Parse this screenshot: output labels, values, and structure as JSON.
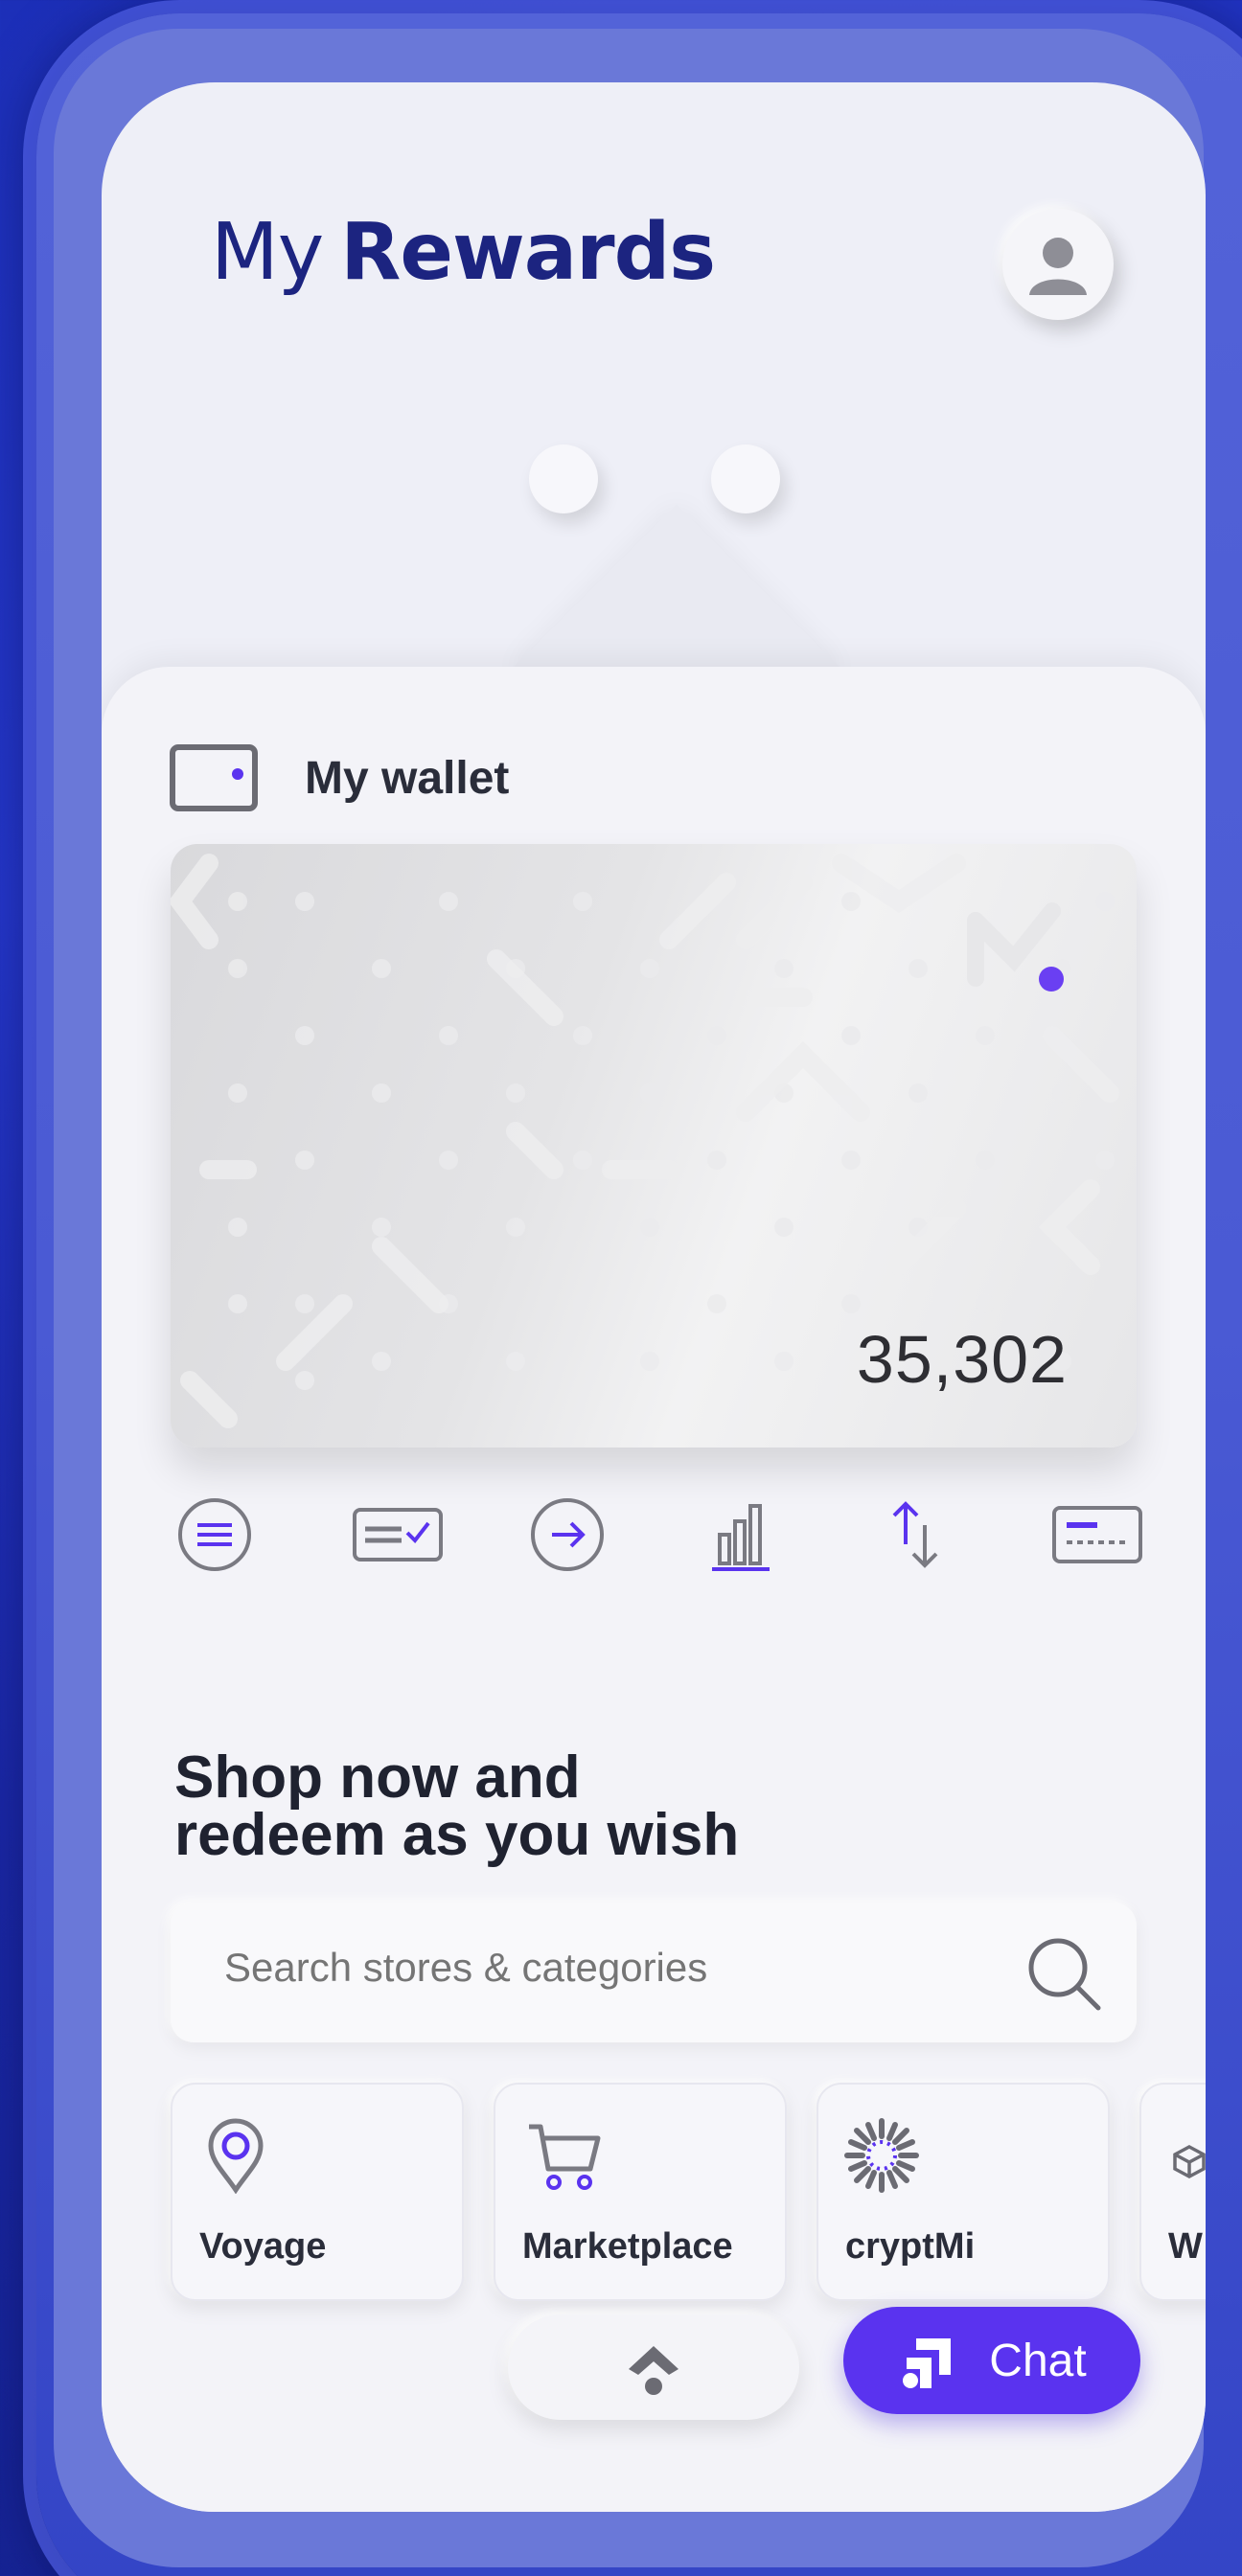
{
  "header": {
    "title_light": "My",
    "title_bold": "Rewards",
    "avatar_icon": "user-avatar-icon"
  },
  "wallet": {
    "label": "My wallet",
    "icon": "wallet-icon",
    "balance": "35,302",
    "accent": "#6a3ff2"
  },
  "actions": [
    {
      "icon": "menu-circle-icon"
    },
    {
      "icon": "card-check-icon"
    },
    {
      "icon": "arrow-right-circle-icon"
    },
    {
      "icon": "bar-chart-icon"
    },
    {
      "icon": "swap-arrows-icon"
    },
    {
      "icon": "credit-card-icon"
    }
  ],
  "shop": {
    "title_line1": "Shop now and",
    "title_line2": "redeem as you wish"
  },
  "search": {
    "placeholder": "Search stores & categories",
    "icon": "search-icon"
  },
  "categories": [
    {
      "label": "Voyage",
      "icon": "location-pin-icon"
    },
    {
      "label": "Marketplace",
      "icon": "shopping-cart-icon"
    },
    {
      "label": "cryptMi",
      "icon": "crypto-burst-icon"
    },
    {
      "label": "W",
      "icon": "cube-icon"
    }
  ],
  "bottom": {
    "up_icon": "chevron-up-icon",
    "chat_label": "Chat",
    "chat_icon": "chat-logo-icon"
  },
  "colors": {
    "primary": "#5a33ef",
    "title": "#1c2480",
    "background": "#1c2fb8"
  }
}
